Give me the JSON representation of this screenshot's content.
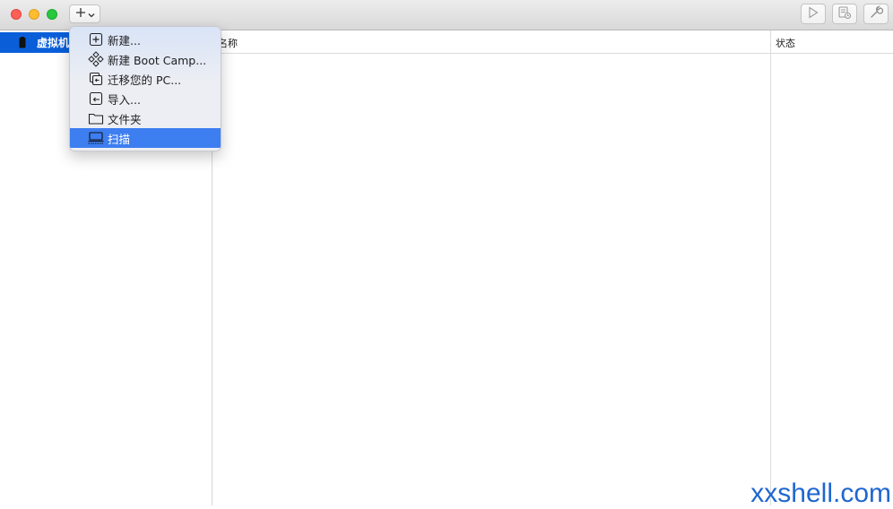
{
  "toolbar": {
    "add_button_icon": "plus-icon",
    "add_button_chevron": "chevron-down-icon",
    "start_button_icon": "play-icon",
    "snapshot_button_icon": "snapshot-icon",
    "settings_button_icon": "wrench-icon"
  },
  "sidebar": {
    "items": [
      {
        "label": "虚拟机",
        "icon": "vm-library-icon",
        "selected": true
      }
    ]
  },
  "table": {
    "columns": [
      "名称",
      "状态"
    ]
  },
  "add_menu": {
    "items": [
      {
        "label": "新建...",
        "icon": "new-plus-icon"
      },
      {
        "label": "新建 Boot Camp...",
        "icon": "bootcamp-icon"
      },
      {
        "label": "迁移您的 PC...",
        "icon": "migrate-pc-icon"
      },
      {
        "label": "导入...",
        "icon": "import-icon"
      },
      {
        "label": "文件夹",
        "icon": "folder-icon"
      },
      {
        "label": "扫描",
        "icon": "scan-icon",
        "selected": true
      }
    ]
  },
  "watermark": {
    "text": "xxshell.com"
  },
  "colors": {
    "selection": "#0a5fd9",
    "menu_highlight": "#3d7ef0",
    "watermark": "#1e66d0"
  }
}
